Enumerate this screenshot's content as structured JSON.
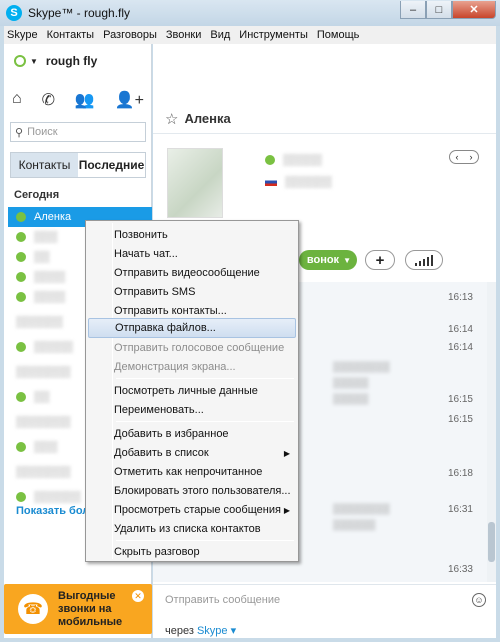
{
  "window": {
    "title": "Skype™ - rough.fly",
    "min": "–",
    "max": "□",
    "close": "✕"
  },
  "menubar": [
    "Skype",
    "Контакты",
    "Разговоры",
    "Звонки",
    "Вид",
    "Инструменты",
    "Помощь"
  ],
  "profile": {
    "name": "rough fly"
  },
  "search": {
    "placeholder": "Поиск"
  },
  "tabs": {
    "contacts": "Контакты",
    "recent": "Последние"
  },
  "contacts": {
    "group_today": "Сегодня",
    "selected_name": "Аленка",
    "show_more": "Показать бол"
  },
  "ad": {
    "text_line1": "Выгодные",
    "text_line2": "звонки на",
    "text_line3": "мобильные"
  },
  "chat": {
    "contact_name": "Аленка",
    "call_label": "вонок",
    "times": [
      "16:13",
      "16:14",
      "16:14",
      "16:15",
      "16:15",
      "16:18",
      "16:31",
      "16:33"
    ],
    "input_placeholder": "Отправить сообщение",
    "via_prefix": "через",
    "via_service": "Skype"
  },
  "context_menu": {
    "items": [
      "Позвонить",
      "Начать чат...",
      "Отправить видеосообщение",
      "Отправить SMS",
      "Отправить контакты...",
      "Отправка файлов...",
      "Отправить голосовое сообщение",
      "Демонстрация экрана...",
      "Посмотреть личные данные",
      "Переименовать...",
      "Добавить в избранное",
      "Добавить в список",
      "Отметить как непрочитанное",
      "Блокировать этого пользователя...",
      "Просмотреть старые сообщения",
      "Удалить из списка контактов",
      "Скрыть разговор"
    ]
  },
  "colors": {
    "accent": "#1a9be6",
    "online": "#7ac142",
    "ad": "#f9a620",
    "call": "#6cb33f"
  }
}
